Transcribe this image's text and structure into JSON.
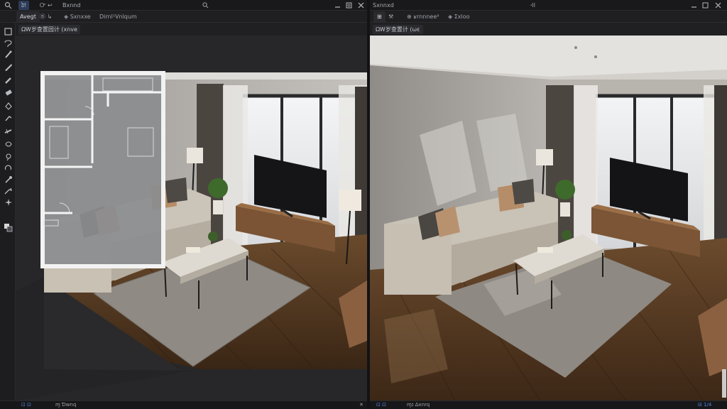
{
  "left_window": {
    "titlebar": {
      "menu_tab": "ঠা",
      "menu_2": "Ꮕ ↩",
      "title": "Bxnnd",
      "center_icon": "search-icon",
      "right_icons": [
        "minimize-icon",
        "copy-icon",
        "close-icon"
      ]
    },
    "tabs": {
      "active": "Avegt",
      "items": [
        "Ⓑ ↳",
        "◈ Sxnxxe",
        "Dirnl¹Vnlqum"
      ]
    },
    "view_label": "ΩᎳ岁查置园计 (xnve",
    "status": {
      "left": "⊡ ⊡",
      "mid": "ɱ   Ɗwnq",
      "right": "✕"
    }
  },
  "right_window": {
    "titlebar": {
      "title": "Sxnnxd",
      "center": "ꞏll",
      "right_icons": [
        "minimize-icon",
        "copy-icon",
        "close-icon"
      ]
    },
    "tabs": {
      "items": [
        "⊞",
        "⚒",
        "⊕ ʁrnnnee⁹",
        "◈ Σxloo"
      ]
    },
    "view_label": "ΩᎳ岁查置计 (ωε",
    "status": {
      "left": "⊡ ⊡",
      "mid": "ɱɪ   Δxnrq",
      "right": "⊟ 1/4"
    }
  },
  "toolbox": {
    "tools": [
      "select-icon",
      "lasso-icon",
      "brush-icon",
      "pen-icon",
      "pencil-icon",
      "eraser-icon",
      "fill-icon",
      "clone-icon",
      "heal-icon",
      "blur-icon",
      "dodge-icon",
      "rotate-icon",
      "picker-icon",
      "measure-icon",
      "sparkle-icon",
      "color-swatch-icon"
    ]
  },
  "colors": {
    "accent": "#2c3c58",
    "wall": "#c9c6c1",
    "floor": "#5b3e26",
    "rug": "#8f8a83",
    "sofa": "#cdc7bd"
  }
}
